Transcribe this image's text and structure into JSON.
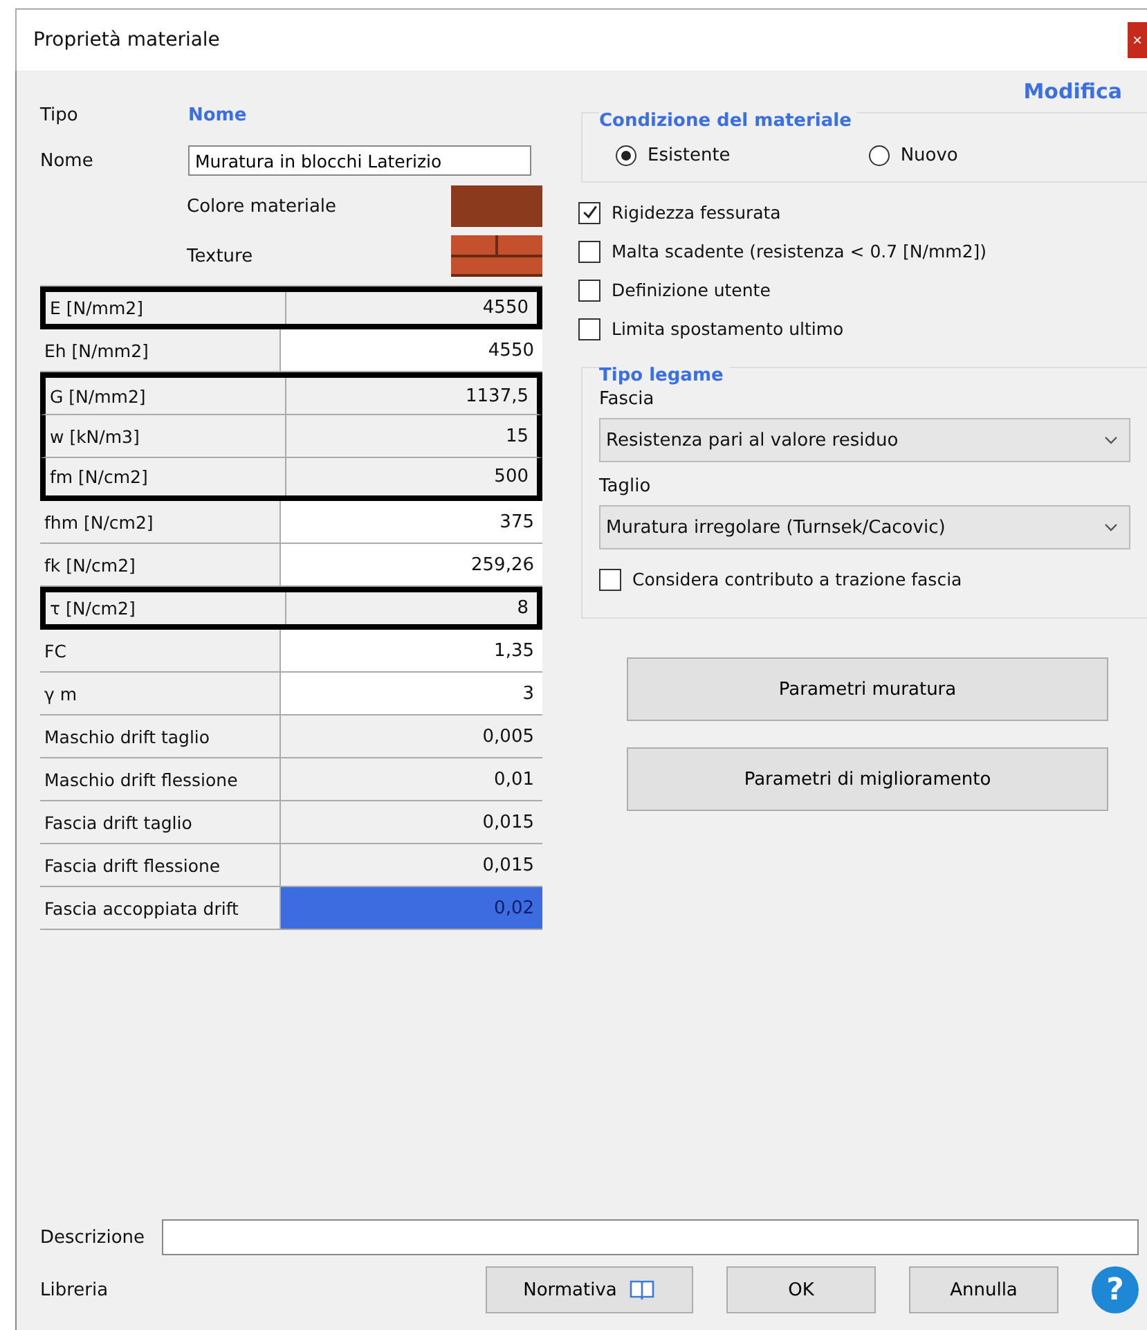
{
  "window": {
    "title": "Proprietà materiale",
    "close": "×"
  },
  "header": {
    "tipo_label": "Tipo",
    "tipo_value": "Nome",
    "modifica_link": "Modifica"
  },
  "name_field": {
    "label": "Nome",
    "value": "Muratura in blocchi Laterizio"
  },
  "color_swatch": {
    "label": "Colore materiale",
    "color": "#8b3a1e"
  },
  "texture": {
    "label": "Texture"
  },
  "properties": [
    {
      "label": "E [N/mm2]",
      "value": "4550",
      "editable": false,
      "highlighted": true,
      "selected": false
    },
    {
      "label": "Eh [N/mm2]",
      "value": "4550",
      "editable": true,
      "highlighted": false,
      "selected": false
    },
    {
      "label": "G [N/mm2]",
      "value": "1137,5",
      "editable": false,
      "highlighted": true,
      "selected": false
    },
    {
      "label": "w [kN/m3]",
      "value": "15",
      "editable": false,
      "highlighted": true,
      "selected": false
    },
    {
      "label": "fm [N/cm2]",
      "value": "500",
      "editable": false,
      "highlighted": true,
      "selected": false
    },
    {
      "label": "fhm [N/cm2]",
      "value": "375",
      "editable": true,
      "highlighted": false,
      "selected": false
    },
    {
      "label": "fk [N/cm2]",
      "value": "259,26",
      "editable": true,
      "highlighted": false,
      "selected": false
    },
    {
      "label": "τ [N/cm2]",
      "value": "8",
      "editable": false,
      "highlighted": true,
      "selected": false
    },
    {
      "label": "FC",
      "value": "1,35",
      "editable": true,
      "highlighted": false,
      "selected": false
    },
    {
      "label": "γ m",
      "value": "3",
      "editable": true,
      "highlighted": false,
      "selected": false
    },
    {
      "label": "Maschio drift taglio",
      "value": "0,005",
      "editable": false,
      "highlighted": false,
      "selected": false
    },
    {
      "label": "Maschio drift flessione",
      "value": "0,01",
      "editable": false,
      "highlighted": false,
      "selected": false
    },
    {
      "label": "Fascia drift taglio",
      "value": "0,015",
      "editable": false,
      "highlighted": false,
      "selected": false
    },
    {
      "label": "Fascia drift flessione",
      "value": "0,015",
      "editable": false,
      "highlighted": false,
      "selected": false
    },
    {
      "label": "Fascia accoppiata drift",
      "value": "0,02",
      "editable": false,
      "highlighted": false,
      "selected": true
    }
  ],
  "condition": {
    "title": "Condizione del materiale",
    "options": [
      {
        "label": "Esistente",
        "selected": true
      },
      {
        "label": "Nuovo",
        "selected": false
      }
    ]
  },
  "options": [
    {
      "label": "Rigidezza fessurata",
      "checked": true
    },
    {
      "label": "Malta scadente (resistenza < 0.7 [N/mm2])",
      "checked": false
    },
    {
      "label": "Definizione utente",
      "checked": false
    },
    {
      "label": "Limita spostamento ultimo",
      "checked": false
    }
  ],
  "legame": {
    "title": "Tipo legame",
    "fascia_label": "Fascia",
    "fascia_value": "Resistenza pari al valore residuo",
    "taglio_label": "Taglio",
    "taglio_value": "Muratura irregolare (Turnsek/Cacovic)",
    "trazione": {
      "label": "Considera contributo a trazione fascia",
      "checked": false
    }
  },
  "side_buttons": [
    "Parametri muratura",
    "Parametri di miglioramento"
  ],
  "description": {
    "label": "Descrizione"
  },
  "footer": {
    "libreria": "Libreria",
    "normativa": "Normativa",
    "ok": "OK",
    "cancel": "Annulla",
    "help": "?"
  }
}
